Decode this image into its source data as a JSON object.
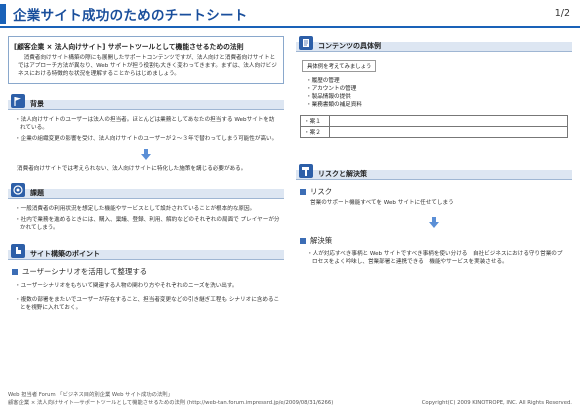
{
  "header": {
    "title": "企業サイト成功のためのチートシート",
    "page": "1/2"
  },
  "intro": {
    "title": "[顧客企業 × 法人向けサイト] サポートツールとして機能させるための法則",
    "text": "　消費者向けサイト構築の際にも展開したサポートコンテンツですが、法人向けと消費者向けサイトとではアプローチ方法が異なり、Web サイトが担う役割も大きく変わってきます。まずは、法人向けビジネスにおける特徴的な状況を理解することからはじめましょう。"
  },
  "background": {
    "heading": "背景",
    "bullets": [
      "・法人向けサイトのユーザーは法人の担当者。ほとんどは業務としてあなたの担当する Webサイトを訪れている。",
      "・企業の組織変更の影響を受け、法人向けサイトのユーザーが２～３年で替わってしまう可能性が高い。"
    ],
    "conclusion": "消費者向けサイトでは考えられない、法人向けサイトに特化した施策を講じる必要がある。"
  },
  "issues": {
    "heading": "課題",
    "bullets": [
      "・一般消費者の利用状況を想定した機能やサービスとして設計されていることが根本的な原因。",
      "・社内で業務を進めるときには、購入、稟議、登録、利用、解約などのそれぞれの局面で プレイヤーが分かれてしまう。"
    ]
  },
  "points": {
    "heading": "サイト構築のポイント",
    "subheading": "ユーザーシナリオを活用して整理する",
    "bullets": [
      "・ユーザーシナリオをもちいて関連する人物の関わり方やそれぞれのニーズを洗い出す。",
      "・複数の部署をまたいでユーザーが存在すること、担当者変更などの引き継ぎ工程も シナリオに含めることを視野に入れておく。"
    ]
  },
  "examples": {
    "heading": "コンテンツの具体例",
    "tag": "具体例を考えてみましょう",
    "items": [
      "・履歴の管理",
      "・アカウントの管理",
      "・製品情報の提供",
      "・業務書類の補足資料"
    ],
    "table": [
      {
        "key": "・案１",
        "value": ""
      },
      {
        "key": "・案２",
        "value": ""
      }
    ]
  },
  "risks": {
    "heading": "リスクと解決策",
    "risk_label": "リスク",
    "risk_text": "営業のサポート機能すべてを Web サイトに任せてしまう",
    "solution_label": "解決策",
    "solution_text": "・人が対応すべき事柄と Web サイトですべき事柄を使い分ける　自社ビジネスにおける守り営業のプロセスをよく吟味し、営業部署と連携できる　機能やサービスを実装させる。"
  },
  "footer": {
    "line1": "Web 担当者 Forum 「ビジネス目的別企業 Web サイト成功の法則」",
    "line2": "顧客企業 × 法人向けサイト―サポートツールとして機能させるための法則 (http://web-tan.forum.impressrd.jp/e/2009/08/31/6266)",
    "copyright": "Copyright(C) 2009 KINOTROPE, INC. All Rights Reserved."
  },
  "colors": {
    "accent": "#1a62b8",
    "section_bar": "#dde6f2",
    "arrow": "#5b8fd6"
  }
}
